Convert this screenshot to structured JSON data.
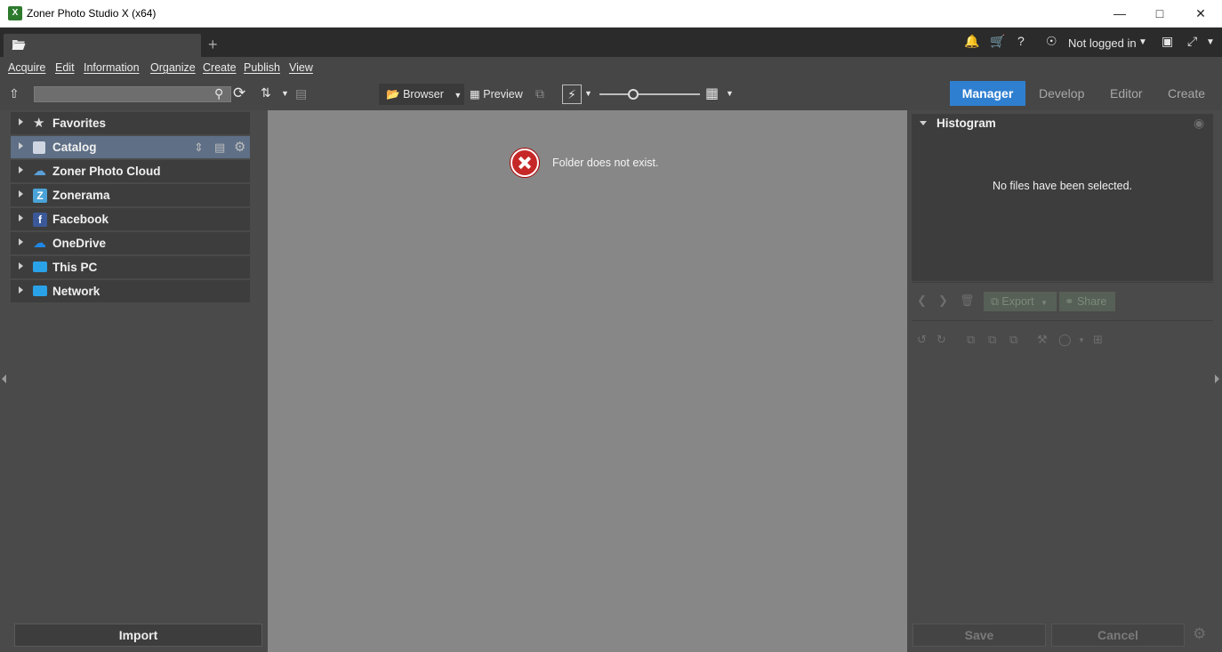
{
  "window": {
    "title": "Zoner Photo Studio X (x64)",
    "app_icon": "X"
  },
  "header": {
    "add_tab": "+",
    "login_label": "Not logged in"
  },
  "menu": [
    "Acquire",
    "Edit",
    "Information",
    "Organize",
    "Create",
    "Publish",
    "View"
  ],
  "toolbar": {
    "search_placeholder": "",
    "browser_label": "Browser",
    "preview_label": "Preview"
  },
  "modes": [
    "Manager",
    "Develop",
    "Editor",
    "Create"
  ],
  "active_mode": "Manager",
  "sidebar": {
    "items": [
      {
        "label": "Favorites",
        "icon": "star-icon",
        "color": "#dcdcdc"
      },
      {
        "label": "Catalog",
        "icon": "catalog-icon",
        "color": "#cfd6e2"
      },
      {
        "label": "Zoner Photo Cloud",
        "icon": "cloud-icon",
        "color": "#5aa0d8"
      },
      {
        "label": "Zonerama",
        "icon": "zonerama-icon",
        "color": "#4aa3d8"
      },
      {
        "label": "Facebook",
        "icon": "facebook-icon",
        "color": "#3b5998"
      },
      {
        "label": "OneDrive",
        "icon": "onedrive-icon",
        "color": "#1e88e5"
      },
      {
        "label": "This PC",
        "icon": "monitor-icon",
        "color": "#2aa2e8"
      },
      {
        "label": "Network",
        "icon": "network-icon",
        "color": "#2aa2e8"
      }
    ],
    "import_label": "Import"
  },
  "center": {
    "error_message": "Folder does not exist."
  },
  "right_panel": {
    "histogram_title": "Histogram",
    "no_files": "No files have been selected.",
    "export_label": "Export",
    "share_label": "Share",
    "save_label": "Save",
    "cancel_label": "Cancel"
  },
  "colors": {
    "accent": "#2f7fd1",
    "error": "#c62828"
  }
}
